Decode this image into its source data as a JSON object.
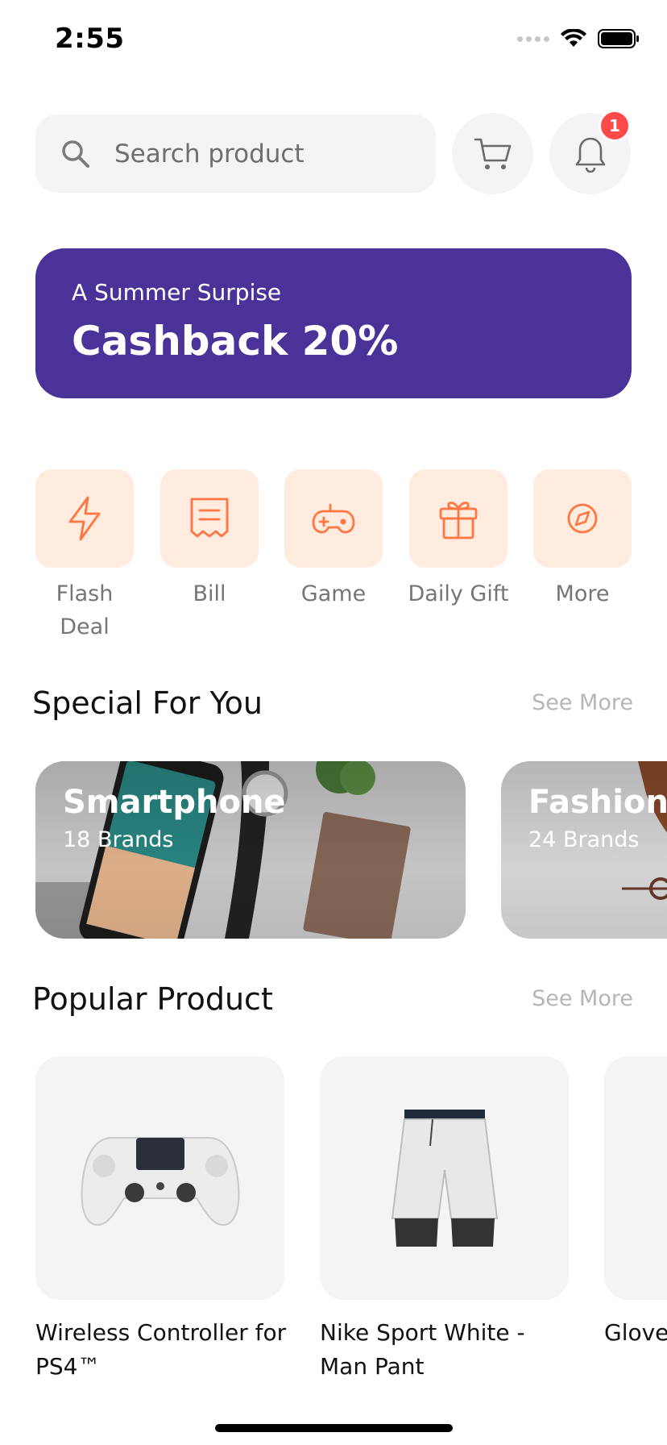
{
  "status_bar": {
    "time": "2:55"
  },
  "search": {
    "placeholder": "Search product"
  },
  "notifications": {
    "count": "1"
  },
  "banner": {
    "subtitle": "A Summer Surpise",
    "title": "Cashback 20%"
  },
  "categories": [
    {
      "label": "Flash Deal",
      "icon": "flash-icon"
    },
    {
      "label": "Bill",
      "icon": "bill-icon"
    },
    {
      "label": "Game",
      "icon": "game-icon"
    },
    {
      "label": "Daily Gift",
      "icon": "gift-icon"
    },
    {
      "label": "More",
      "icon": "discover-icon"
    }
  ],
  "special": {
    "title": "Special For You",
    "see_more": "See More",
    "cards": [
      {
        "title": "Smartphone",
        "subtitle": "18 Brands"
      },
      {
        "title": "Fashion",
        "subtitle": "24 Brands"
      }
    ]
  },
  "popular": {
    "title": "Popular Product",
    "see_more": "See More",
    "products": [
      {
        "name": "Wireless Controller for PS4™"
      },
      {
        "name": "Nike Sport White - Man Pant"
      },
      {
        "name": "Glove Polygon"
      }
    ]
  },
  "colors": {
    "accent": "#ff7643",
    "banner": "#4a3298",
    "category_bg": "#ffecdf",
    "surface": "#f4f4f6",
    "badge": "#ff4a4a"
  }
}
